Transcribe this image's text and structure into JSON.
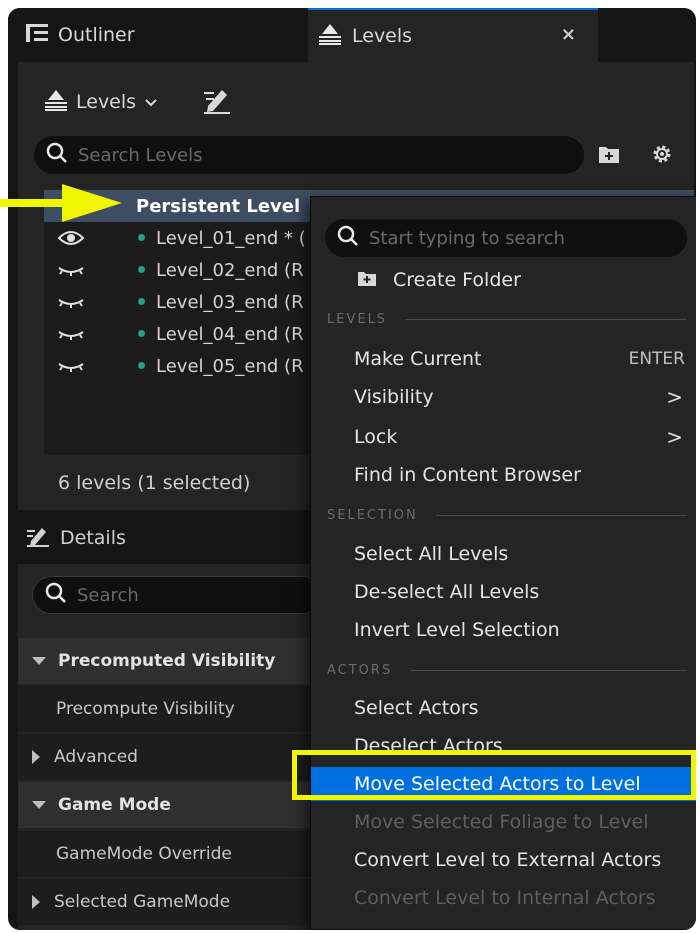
{
  "tabs": {
    "outliner": {
      "label": "Outliner",
      "icon": "outliner-list-icon"
    },
    "levels": {
      "label": "Levels",
      "icon": "levels-stack-icon",
      "close": "×"
    }
  },
  "levels_toolbar": {
    "dropdown_label": "Levels",
    "edit_icon": "edit-pencil-icon"
  },
  "levels_search": {
    "placeholder": "Search Levels"
  },
  "levels": [
    {
      "name": "Persistent Level",
      "selected": true
    },
    {
      "name": "Level_01_end * (",
      "visible": true
    },
    {
      "name": "Level_02_end (R",
      "visible": false
    },
    {
      "name": "Level_03_end (R",
      "visible": false
    },
    {
      "name": "Level_04_end (R",
      "visible": false
    },
    {
      "name": "Level_05_end (R",
      "visible": false
    }
  ],
  "levels_status": "6 levels (1 selected)",
  "details": {
    "title": "Details",
    "search_placeholder": "Search",
    "rows": [
      {
        "label": "Precomputed Visibility",
        "kind": "category"
      },
      {
        "label": "Precompute Visibility",
        "kind": "property"
      },
      {
        "label": "Advanced",
        "kind": "subcategory"
      },
      {
        "label": "Game Mode",
        "kind": "category"
      },
      {
        "label": "GameMode Override",
        "kind": "property"
      },
      {
        "label": "Selected GameMode",
        "kind": "subcategory"
      }
    ]
  },
  "context_menu": {
    "search_placeholder": "Start typing to search",
    "create_folder": "Create Folder",
    "sections": {
      "levels": "LEVELS",
      "selection": "SELECTION",
      "actors": "ACTORS"
    },
    "items": {
      "make_current": {
        "label": "Make Current",
        "shortcut": "ENTER"
      },
      "visibility": {
        "label": "Visibility",
        "arrow": ">"
      },
      "lock": {
        "label": "Lock",
        "arrow": ">"
      },
      "find_in_content_browser": {
        "label": "Find in Content Browser"
      },
      "select_all_levels": {
        "label": "Select All Levels"
      },
      "deselect_all_levels": {
        "label": "De-select All Levels"
      },
      "invert_level_selection": {
        "label": "Invert Level Selection"
      },
      "select_actors": {
        "label": "Select Actors"
      },
      "deselect_actors": {
        "label": "Deselect Actors"
      },
      "move_selected_actors": {
        "label": "Move Selected Actors to Level",
        "highlighted": true
      },
      "move_selected_foliage": {
        "label": "Move Selected Foliage to Level",
        "disabled": true
      },
      "convert_to_external": {
        "label": "Convert Level to External Actors"
      },
      "convert_to_internal": {
        "label": "Convert Level to Internal Actors",
        "disabled": true
      }
    }
  },
  "colors": {
    "selection_blue": "#0070e0",
    "annotation_yellow": "#f0f500",
    "level_dot": "#2a9d8f",
    "selected_row": "#3e4e62"
  }
}
